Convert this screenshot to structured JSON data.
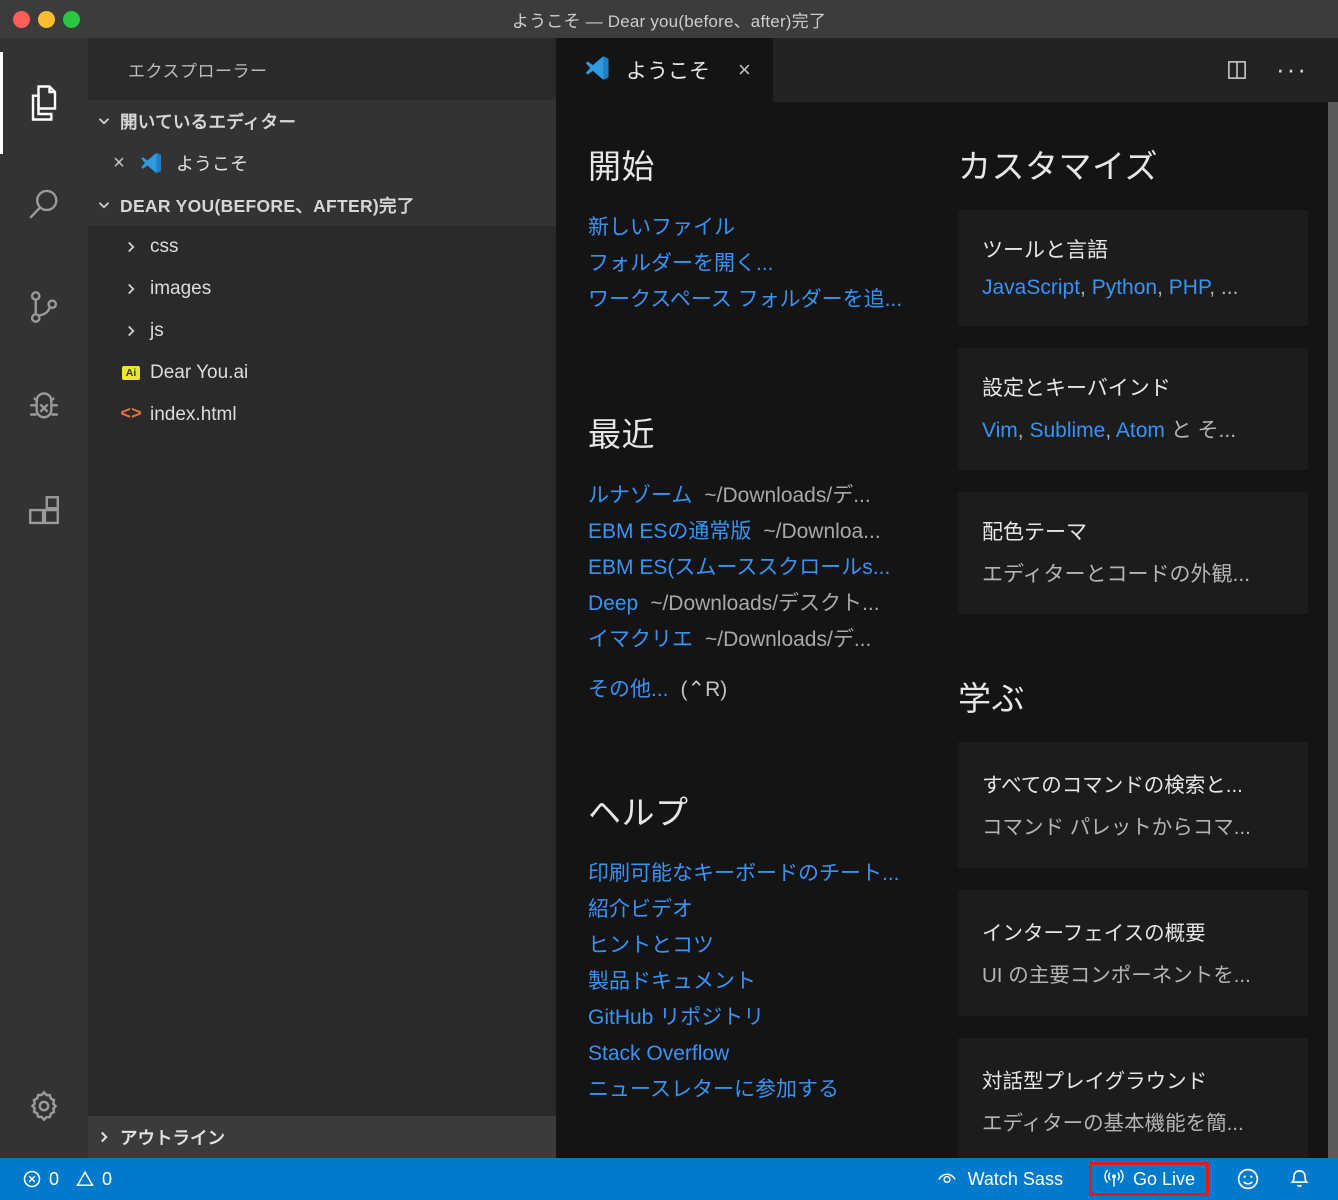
{
  "titlebar": {
    "title": "ようこそ — Dear you(before、after)完了",
    "traffic": {
      "close": "close-button",
      "minimize": "minimize-button",
      "maximize": "maximize-button"
    }
  },
  "activitybar": {
    "items": [
      {
        "name": "explorer",
        "icon": "files-icon",
        "active": true
      },
      {
        "name": "search",
        "icon": "search-icon",
        "active": false
      },
      {
        "name": "source-control",
        "icon": "source-control-icon",
        "active": false
      },
      {
        "name": "run-and-debug",
        "icon": "debug-icon",
        "active": false
      },
      {
        "name": "extensions",
        "icon": "extensions-icon",
        "active": false
      }
    ],
    "bottom": {
      "name": "manage",
      "icon": "gear-icon"
    }
  },
  "sidebar": {
    "title": "エクスプローラー",
    "open_editors": {
      "label": "開いているエディター",
      "expanded": true,
      "items": [
        {
          "label": "ようこそ",
          "icon": "vscode-icon",
          "close": "×"
        }
      ]
    },
    "workspace": {
      "label": "DEAR YOU(BEFORE、AFTER)完了",
      "expanded": true,
      "children": [
        {
          "label": "css",
          "type": "folder",
          "expanded": false
        },
        {
          "label": "images",
          "type": "folder",
          "expanded": false
        },
        {
          "label": "js",
          "type": "folder",
          "expanded": false
        },
        {
          "label": "Dear You.ai",
          "type": "file",
          "icon": "ai-file-icon",
          "badge": "Ai"
        },
        {
          "label": "index.html",
          "type": "file",
          "icon": "html-file-icon",
          "glyph": "<>"
        }
      ]
    },
    "outline": {
      "label": "アウトライン",
      "expanded": false
    }
  },
  "editor": {
    "tabs": [
      {
        "label": "ようこそ",
        "icon": "vscode-icon",
        "close": "×",
        "active": true
      }
    ],
    "actions": [
      {
        "name": "split-editor",
        "icon": "split-editor-icon"
      },
      {
        "name": "more-actions",
        "icon": "ellipsis-icon",
        "glyph": "···"
      }
    ]
  },
  "welcome": {
    "start": {
      "heading": "開始",
      "links": [
        "新しいファイル",
        "フォルダーを開く...",
        "ワークスペース フォルダーを追..."
      ]
    },
    "recent": {
      "heading": "最近",
      "items": [
        {
          "name": "ルナゾーム",
          "path": "~/Downloads/デ..."
        },
        {
          "name": "EBM ESの通常版",
          "path": "~/Downloa..."
        },
        {
          "name": "EBM ES(スムーススクロールs...",
          "path": ""
        },
        {
          "name": "Deep",
          "path": "~/Downloads/デスクト..."
        },
        {
          "name": "イマクリエ",
          "path": "~/Downloads/デ..."
        }
      ],
      "more_label": "その他...",
      "more_shortcut": "(⌃R)"
    },
    "help": {
      "heading": "ヘルプ",
      "links": [
        "印刷可能なキーボードのチート...",
        "紹介ビデオ",
        "ヒントとコツ",
        "製品ドキュメント",
        "GitHub リポジトリ",
        "Stack Overflow",
        "ニュースレターに参加する"
      ]
    },
    "customize": {
      "heading": "カスタマイズ",
      "cards": [
        {
          "title": "ツールと言語",
          "links": [
            "JavaScript",
            "Python",
            "PHP"
          ],
          "suffix": ", ..."
        },
        {
          "title": "設定とキーバインド",
          "links": [
            "Vim",
            "Sublime",
            "Atom"
          ],
          "suffix": " と そ..."
        },
        {
          "title": "配色テーマ",
          "subtitle": "エディターとコードの外観..."
        }
      ]
    },
    "learn": {
      "heading": "学ぶ",
      "cards": [
        {
          "title": "すべてのコマンドの検索と...",
          "subtitle": "コマンド パレットからコマ..."
        },
        {
          "title": "インターフェイスの概要",
          "subtitle": "UI の主要コンポーネントを..."
        },
        {
          "title": "対話型プレイグラウンド",
          "subtitle": "エディターの基本機能を簡..."
        }
      ]
    }
  },
  "statusbar": {
    "errors": "0",
    "warnings": "0",
    "watch_sass": "Watch Sass",
    "go_live": "Go Live",
    "feedback_icon": "smiley-icon",
    "notifications_icon": "bell-icon",
    "accent": "#007acc",
    "highlight": "#f01414"
  }
}
